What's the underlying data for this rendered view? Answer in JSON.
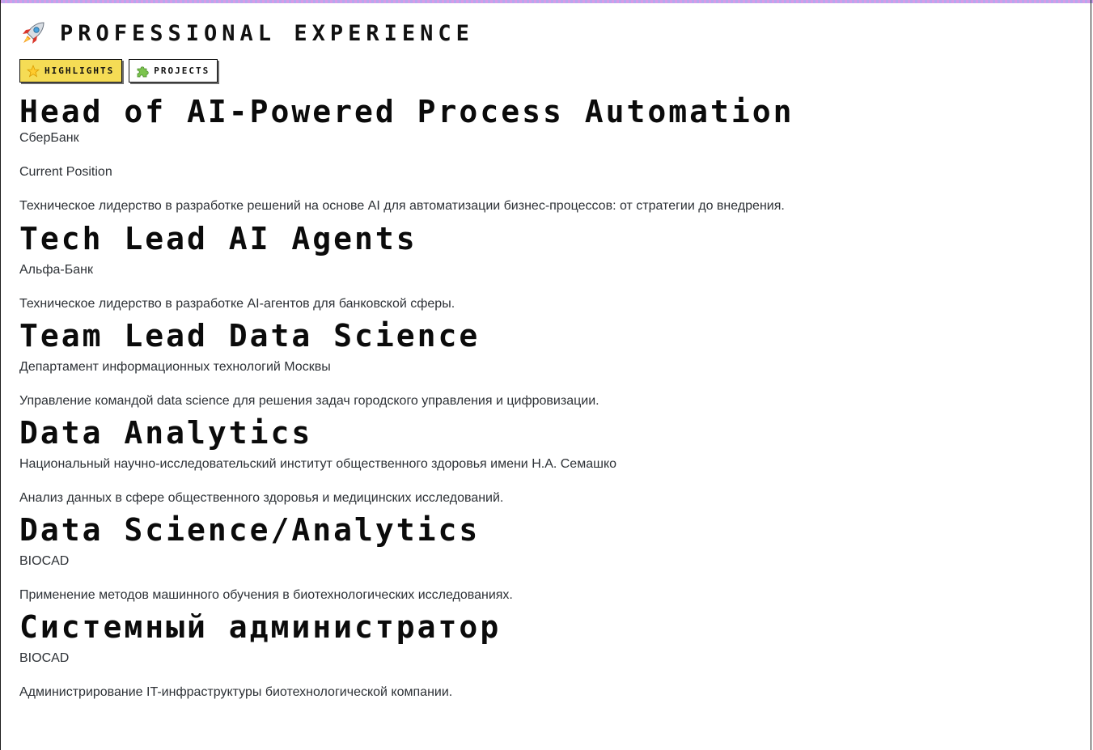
{
  "section": {
    "title": "PROFESSIONAL EXPERIENCE",
    "icon": "rocket-icon"
  },
  "tabs": [
    {
      "label": "HIGHLIGHTS",
      "icon": "star-icon",
      "active": true
    },
    {
      "label": "PROJECTS",
      "icon": "puzzle-icon",
      "active": false
    }
  ],
  "jobs": [
    {
      "title": "Head of AI-Powered Process Automation",
      "company": "СберБанк",
      "status": "Current Position",
      "description": "Техническое лидерство в разработке решений на основе AI для автоматизации бизнес-процессов: от стратегии до внедрения."
    },
    {
      "title": "Tech Lead AI Agents",
      "company": "Альфа-Банк",
      "description": "Техническое лидерство в разработке AI-агентов для банковской сферы."
    },
    {
      "title": "Team Lead Data Science",
      "company": "Департамент информационных технологий Москвы",
      "description": "Управление командой data science для решения задач городского управления и цифровизации."
    },
    {
      "title": "Data Analytics",
      "company": "Национальный научно-исследовательский институт общественного здоровья имени Н.А. Семашко",
      "description": "Анализ данных в сфере общественного здоровья и медицинских исследований."
    },
    {
      "title": "Data Science/Analytics",
      "company": "BIOCAD",
      "description": "Применение методов машинного обучения в биотехнологических исследованиях."
    },
    {
      "title": "Системный администратор",
      "company": "BIOCAD",
      "description": "Администрирование IT-инфраструктуры биотехнологической компании."
    }
  ],
  "colors": {
    "active_tab": "#f5dc55",
    "top_border": "#d79be6"
  }
}
